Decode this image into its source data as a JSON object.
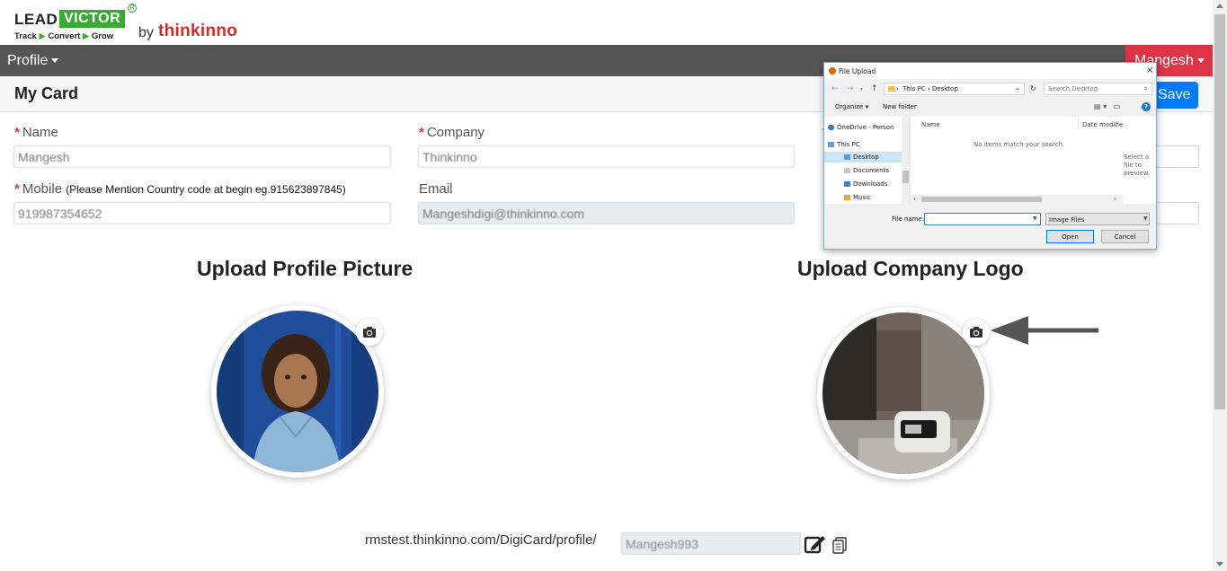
{
  "brand": {
    "lead": "LEAD",
    "victor": "VICTOR",
    "reg": "R",
    "tagline": [
      "Track",
      "Convert",
      "Grow"
    ],
    "by": "by",
    "company": "thinkinno"
  },
  "nav": {
    "profile_label": "Profile",
    "user_label": "Mangesh"
  },
  "card": {
    "title": "My Card",
    "save_label": "Save"
  },
  "form": {
    "name": {
      "label": "Name",
      "required": "*",
      "value": "Mangesh"
    },
    "company": {
      "label": "Company",
      "required": "*",
      "value": "Thinkinno"
    },
    "mobile": {
      "label": "Mobile",
      "required": "*",
      "hint": "(Please Mention Country code at begin eg.915623897845)",
      "value": "919987354652"
    },
    "email": {
      "label": "Email",
      "value": "Mangeshdigi@thinkinno.com"
    },
    "third_required": "*"
  },
  "uploads": {
    "profile_title": "Upload Profile Picture",
    "logo_title": "Upload Company Logo",
    "camera_icon": "camera-icon"
  },
  "profile_url": {
    "prefix": "rmstest.thinkinno.com/DigiCard/profile/",
    "value": "Mangesh993"
  },
  "file_dialog": {
    "title": "File Upload",
    "close": "×",
    "path": [
      "This PC",
      "Desktop"
    ],
    "search_placeholder": "Search Desktop",
    "organize_label": "Organize ▾",
    "new_folder_label": "New folder",
    "tree": [
      "OneDrive - Person",
      "This PC",
      "Desktop",
      "Documents",
      "Downloads",
      "Music"
    ],
    "col_name": "Name",
    "col_date": "Date modifie",
    "empty_message": "No items match your search.",
    "preview_hint": "Select a file to preview.",
    "file_name_label": "File name:",
    "file_type": "Image Files",
    "open_label": "Open",
    "cancel_label": "Cancel"
  },
  "colors": {
    "nav_bg": "#555555",
    "user_button": "#dc3545",
    "save_button": "#007bff",
    "brand_green": "#3aa935",
    "brand_red": "#d62a2a"
  }
}
